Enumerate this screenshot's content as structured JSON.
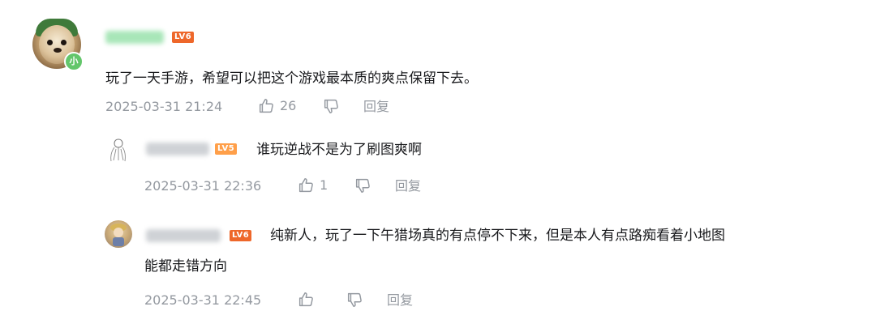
{
  "colors": {
    "level6": "#ee672a",
    "level5": "#ff9f49",
    "meta_text": "#9499a0",
    "body_text": "#18191c",
    "xiao_badge": "#63c66b"
  },
  "main_comment": {
    "user_badge": "小",
    "level": "LV6",
    "text": "玩了一天手游，希望可以把这个游戏最本质的爽点保留下去。",
    "time": "2025-03-31 21:24",
    "likes": "26",
    "reply_label": "回复"
  },
  "replies": [
    {
      "level": "LV5",
      "text": "谁玩逆战不是为了刷图爽啊",
      "time": "2025-03-31 22:36",
      "likes": "1",
      "reply_label": "回复"
    },
    {
      "level": "LV6",
      "text_line1": "纯新人，玩了一下午猎场真的有点停不下来，但是本人有点路痴看着小地图",
      "text_line2": "能都走错方向",
      "time": "2025-03-31 22:45",
      "reply_label": "回复"
    }
  ]
}
